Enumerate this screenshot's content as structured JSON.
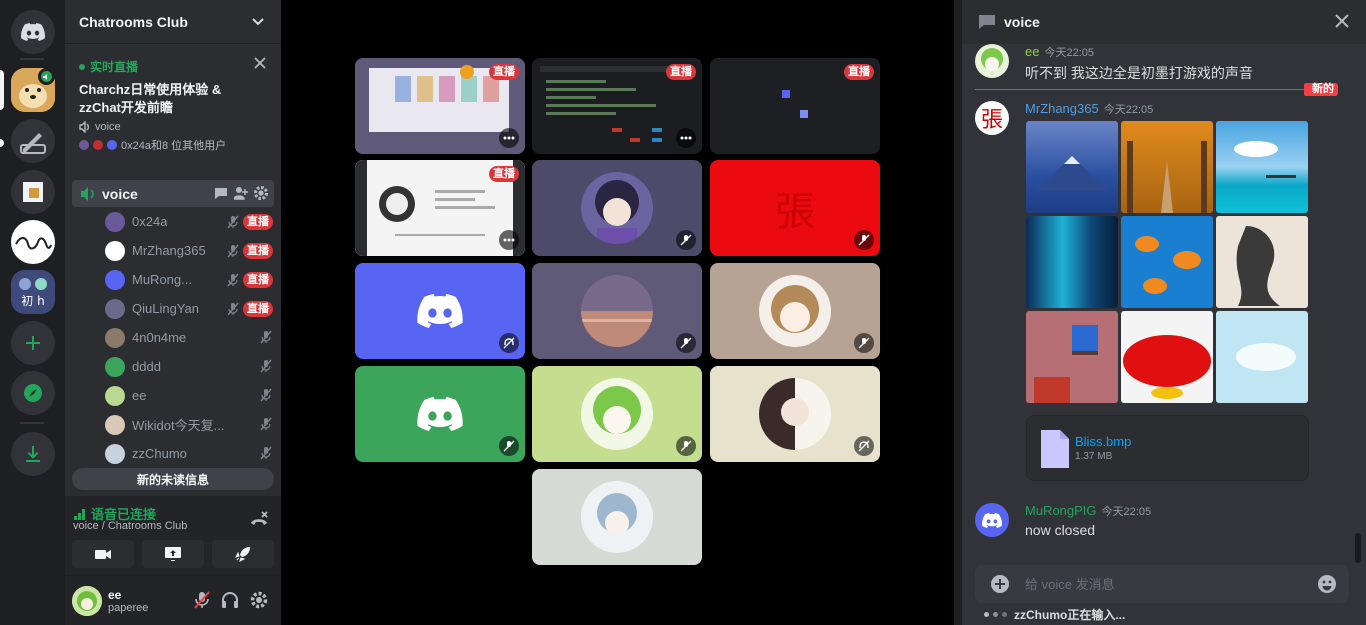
{
  "server_name": "Chatrooms Club",
  "event": {
    "status": "实时直播",
    "title": "Charchz日常使用体验 & zzChat开发前瞻",
    "channel": "voice",
    "attendees": "0x24a和8 位其他用户"
  },
  "voice_channel": "voice",
  "live_label": "直播",
  "members": [
    {
      "name": "0x24a",
      "live": true
    },
    {
      "name": "MrZhang365",
      "live": true
    },
    {
      "name": "MuRong...",
      "live": true
    },
    {
      "name": "QiuLingYan",
      "live": true
    },
    {
      "name": "4n0n4me",
      "live": false
    },
    {
      "name": "dddd",
      "live": false
    },
    {
      "name": "ee",
      "live": false
    },
    {
      "name": "Wikidot今天复...",
      "live": false
    },
    {
      "name": "zzChumo",
      "live": false
    }
  ],
  "unread_banner": "新的未读信息",
  "voice_connection": {
    "status": "语音已连接",
    "location": "voice / Chatrooms Club"
  },
  "user": {
    "name": "ee",
    "status": "paperee"
  },
  "stage_grid": "4x4 stream tiles",
  "chat": {
    "channel": "voice",
    "new_label": "新的",
    "messages": [
      {
        "author": "ee",
        "time": "今天22:05",
        "text": "听不到 我这边全是初墨打游戏的声音",
        "color": "#8fce4f"
      },
      {
        "author": "MrZhang365",
        "time": "今天22:05",
        "text": "",
        "color": "#4e9fe6"
      },
      {
        "author": "MuRongPIG",
        "time": "今天22:05",
        "text": "now closed",
        "color": "#23a55a"
      }
    ],
    "attachment": {
      "name": "Bliss.bmp",
      "size": "1.37 MB"
    },
    "composer_placeholder": "给 voice 发消息",
    "typing": "zzChumo正在输入..."
  },
  "colors": {
    "accent": "#5865f2",
    "live": "#da373c",
    "online": "#23a55a"
  }
}
